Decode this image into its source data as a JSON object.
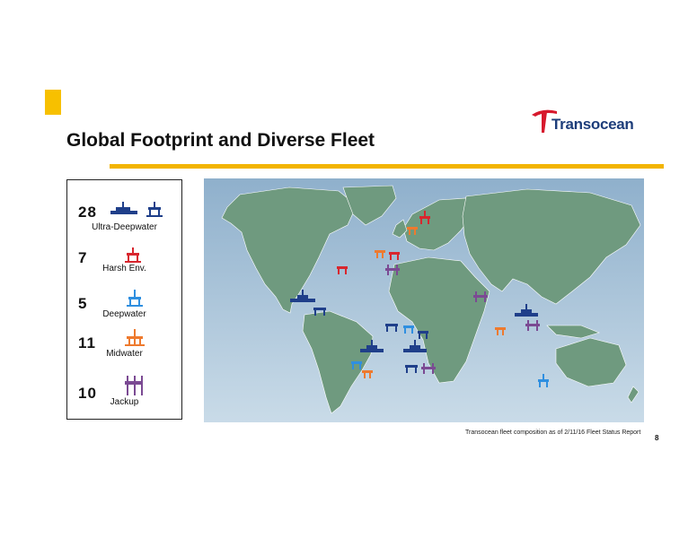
{
  "header": {
    "title": "Global Footprint and Diverse Fleet",
    "logo_text": "Transocean",
    "accent_color": "#f2b400",
    "logo_color": "#1d3d7a",
    "logo_mark_color": "#d7192d"
  },
  "legend": [
    {
      "count": "28",
      "label": "Ultra-Deepwater",
      "icon": "drillship-and-semisub-icon",
      "color": "#1f3f8a"
    },
    {
      "count": "7",
      "label": "Harsh Env.",
      "icon": "harsh-environment-rig-icon",
      "color": "#d8262e"
    },
    {
      "count": "5",
      "label": "Deepwater",
      "icon": "deepwater-rig-icon",
      "color": "#2f8fe0"
    },
    {
      "count": "11",
      "label": "Midwater",
      "icon": "midwater-rig-icon",
      "color": "#ee7a2e"
    },
    {
      "count": "10",
      "label": "Jackup",
      "icon": "jackup-rig-icon",
      "color": "#7b4a93"
    }
  ],
  "map": {
    "ocean_color": "#b9cfe0",
    "land_color": "#6f9a7f"
  },
  "footer": {
    "footnote": "Transocean fleet composition as of 2/11/16 Fleet Status Report",
    "page_number": "8"
  }
}
